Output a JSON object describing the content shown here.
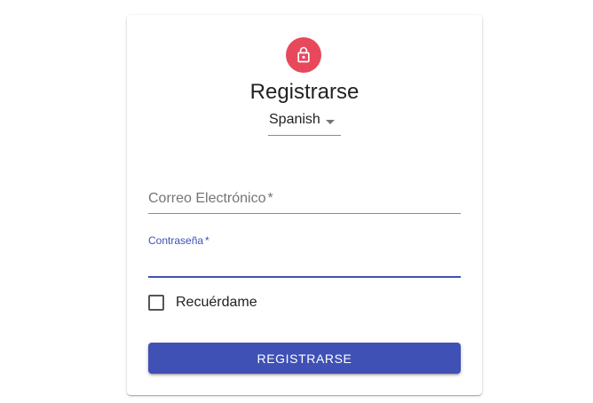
{
  "colors": {
    "avatar_bg": "#e8485c",
    "primary": "#3f51b5",
    "text": "#222222",
    "muted": "#757575"
  },
  "header": {
    "icon": "lock-icon",
    "title": "Registrarse"
  },
  "language": {
    "selected": "Spanish"
  },
  "form": {
    "email": {
      "label": "Correo Electrónico",
      "required_mark": "*",
      "value": ""
    },
    "password": {
      "label": "Contraseña",
      "required_mark": "*",
      "value": ""
    },
    "remember": {
      "label": "Recuérdame",
      "checked": false
    },
    "submit_label": "REGISTRARSE"
  }
}
